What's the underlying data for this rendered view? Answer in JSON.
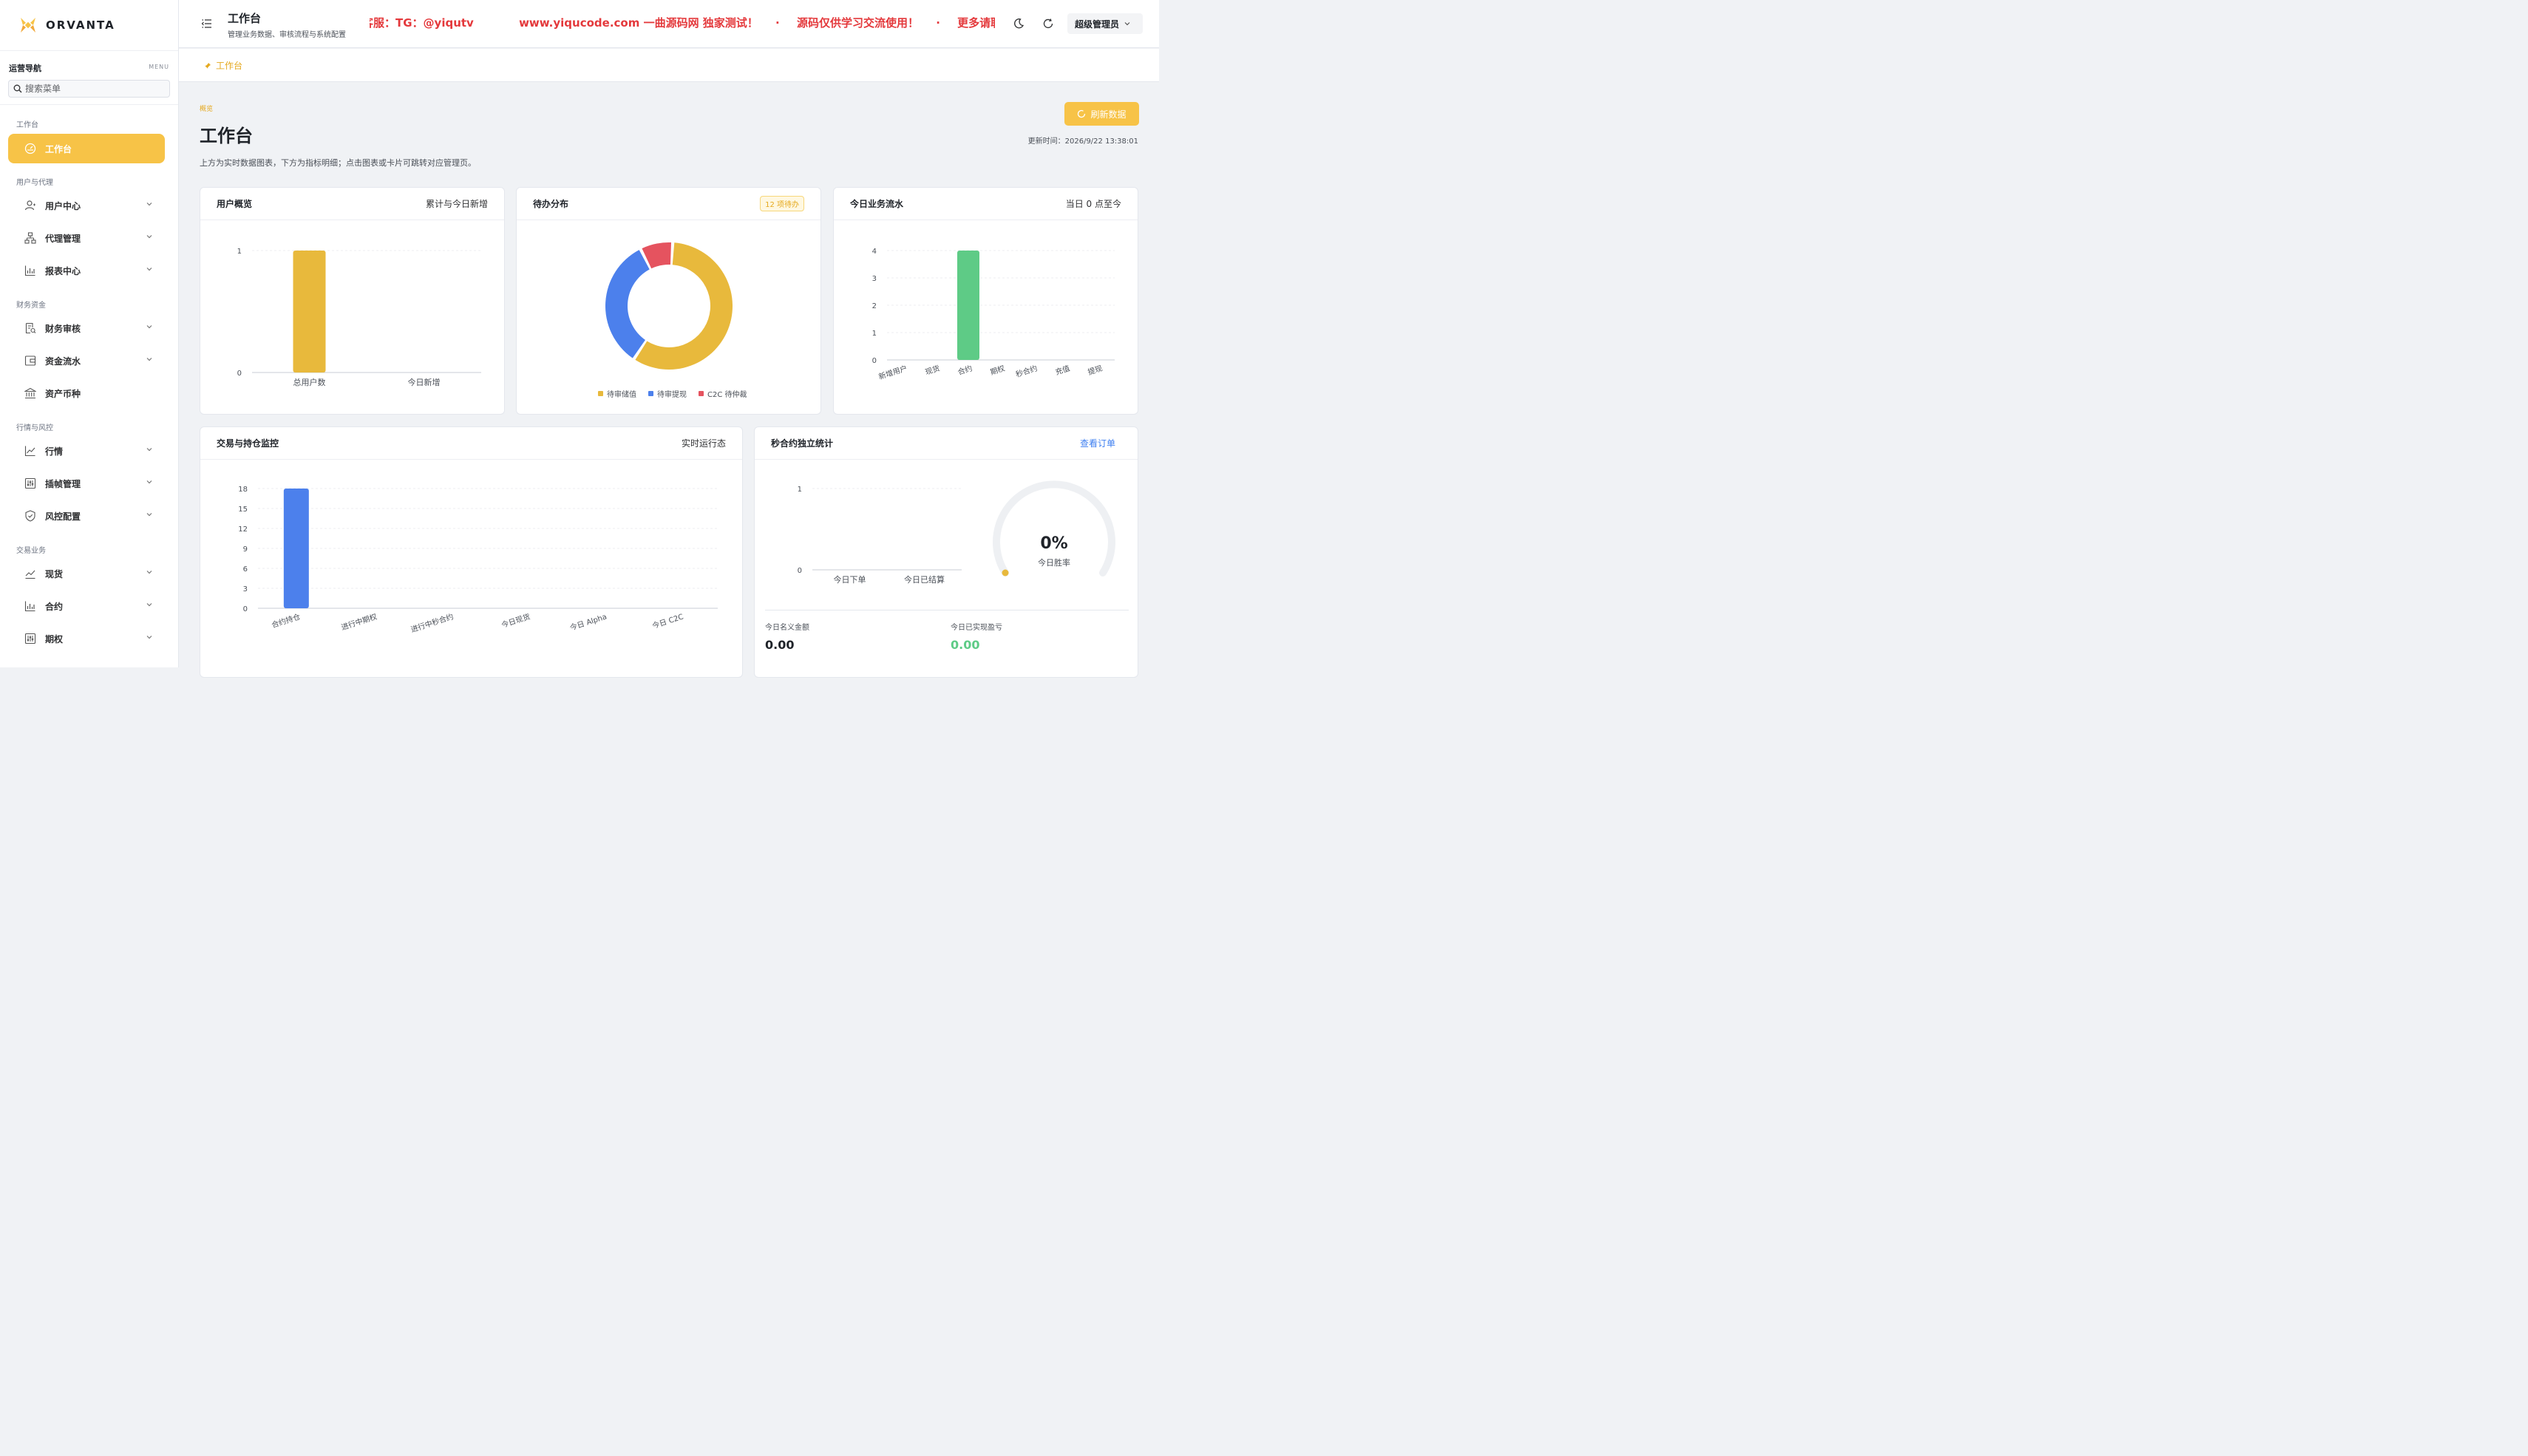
{
  "brand": {
    "name": "ORVANTA"
  },
  "sidebar": {
    "nav_title": "运营导航",
    "menu_tag": "MENU",
    "search_placeholder": "搜索菜单",
    "groups": [
      {
        "label": "工作台"
      },
      {
        "label": "用户与代理"
      },
      {
        "label": "财务资金"
      },
      {
        "label": "行情与风控"
      },
      {
        "label": "交易业务"
      }
    ],
    "items": [
      {
        "label": "工作台",
        "icon": "dashboard-icon",
        "active": true
      },
      {
        "label": "用户中心",
        "icon": "user-icon"
      },
      {
        "label": "代理管理",
        "icon": "org-chart-icon"
      },
      {
        "label": "报表中心",
        "icon": "bar-chart-icon"
      },
      {
        "label": "财务审核",
        "icon": "audit-document-icon"
      },
      {
        "label": "资金流水",
        "icon": "wallet-icon"
      },
      {
        "label": "资产币种",
        "icon": "bank-icon"
      },
      {
        "label": "行情",
        "icon": "line-chart-icon"
      },
      {
        "label": "插帧管理",
        "icon": "sliders-icon"
      },
      {
        "label": "风控配置",
        "icon": "shield-icon"
      },
      {
        "label": "现货",
        "icon": "trend-icon"
      },
      {
        "label": "合约",
        "icon": "bar-chart-icon"
      },
      {
        "label": "期权",
        "icon": "sliders-icon"
      }
    ]
  },
  "header": {
    "title": "工作台",
    "subtitle": "管理业务数据、审核流程与系统配置",
    "marquee": [
      "客服：TG：@yiqutv",
      "www.yiqucode.com 一曲源码网 独家测试！",
      "源码仅供学习交流使用！",
      "更多请联系唯"
    ],
    "marquee_separator": "·",
    "user": "超级管理员"
  },
  "breadcrumb": {
    "label": "工作台"
  },
  "main": {
    "eyebrow": "概览",
    "title": "工作台",
    "description": "上方为实时数据图表，下方为指标明细；点击图表或卡片可跳转对应管理页。",
    "refresh_label": "刷新数据",
    "update_time": "更新时间：2026/9/22 13:38:01"
  },
  "cards": {
    "user_overview": {
      "title": "用户概览",
      "extra": "累计与今日新增"
    },
    "pending": {
      "title": "待办分布",
      "badge": "12 项待办"
    },
    "today_flow": {
      "title": "今日业务流水",
      "extra": "当日 0 点至今"
    },
    "trade_monitor": {
      "title": "交易与持仓监控",
      "extra": "实时运行态"
    },
    "second_contract": {
      "title": "秒合约独立统计",
      "link": "查看订单",
      "gauge_value": "0%",
      "gauge_label": "今日胜率",
      "notional_label": "今日名义金额",
      "notional_value": "0.00",
      "pnl_label": "今日已实现盈亏",
      "pnl_value": "0.00"
    }
  },
  "colors": {
    "accent": "#f7c347",
    "gold": "#e8b93c",
    "blue": "#4c80ec",
    "red": "#e5535f",
    "green": "#5ecb86"
  },
  "chart_data": [
    {
      "type": "bar",
      "categories": [
        "总用户数",
        "今日新增"
      ],
      "values": [
        1,
        0
      ],
      "ylim": [
        0,
        1
      ],
      "yticks": [
        0,
        1
      ],
      "color": "#e8b93c"
    },
    {
      "type": "pie",
      "categories": [
        "待审储值",
        "待审提现",
        "C2C 待仲裁"
      ],
      "values": [
        7,
        4,
        1
      ],
      "colors": [
        "#e8b93c",
        "#4c80ec",
        "#e5535f"
      ],
      "legend": "bottom"
    },
    {
      "type": "bar",
      "categories": [
        "新增用户",
        "现货",
        "合约",
        "期权",
        "秒合约",
        "充值",
        "提现"
      ],
      "values": [
        0,
        0,
        4,
        0,
        0,
        0,
        0
      ],
      "ylim": [
        0,
        4
      ],
      "yticks": [
        0,
        1,
        2,
        3,
        4
      ],
      "color": "#5ecb86"
    },
    {
      "type": "bar",
      "categories": [
        "合约持仓",
        "进行中期权",
        "进行中秒合约",
        "今日现货",
        "今日 Alpha",
        "今日 C2C"
      ],
      "values": [
        18,
        0,
        0,
        0,
        0,
        0
      ],
      "ylim": [
        0,
        18
      ],
      "yticks": [
        0,
        3,
        6,
        9,
        12,
        15,
        18
      ],
      "color": "#4c80ec"
    },
    {
      "type": "bar",
      "categories": [
        "今日下单",
        "今日已结算"
      ],
      "values": [
        0,
        0
      ],
      "ylim": [
        0,
        1
      ],
      "yticks": [
        0,
        1
      ],
      "color": "#4c80ec"
    }
  ]
}
